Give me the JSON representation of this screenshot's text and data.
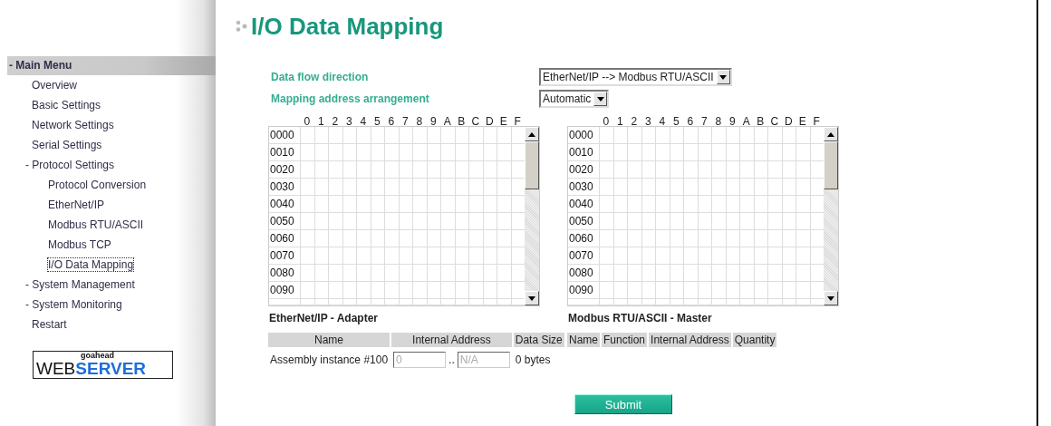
{
  "sidebar": {
    "header": "- Main Menu",
    "items": [
      {
        "label": "Overview",
        "kind": "page",
        "selected": false
      },
      {
        "label": "Basic Settings",
        "kind": "page",
        "selected": false
      },
      {
        "label": "Network Settings",
        "kind": "page",
        "selected": false
      },
      {
        "label": "Serial Settings",
        "kind": "page",
        "selected": false
      },
      {
        "label": "- Protocol Settings",
        "kind": "folder",
        "selected": false,
        "children": [
          {
            "label": "Protocol Conversion",
            "kind": "page",
            "selected": false
          },
          {
            "label": "EtherNet/IP",
            "kind": "page",
            "selected": false
          },
          {
            "label": "Modbus RTU/ASCII",
            "kind": "page",
            "selected": false
          },
          {
            "label": "Modbus TCP",
            "kind": "page",
            "selected": false
          },
          {
            "label": "I/O Data Mapping",
            "kind": "page",
            "selected": true
          }
        ]
      },
      {
        "label": "- System Management",
        "kind": "folder",
        "selected": false
      },
      {
        "label": "- System Monitoring",
        "kind": "folder",
        "selected": false
      },
      {
        "label": "Restart",
        "kind": "page",
        "selected": false
      }
    ],
    "logo": {
      "small": "goahead",
      "left": "WEB",
      "right": "SERVER"
    }
  },
  "title": "I/O Data Mapping",
  "settings": [
    {
      "label": "Data flow direction",
      "value": "EtherNet/IP --> Modbus RTU/ASCII"
    },
    {
      "label": "Mapping address arrangement",
      "value": "Automatic"
    }
  ],
  "grids": [
    {
      "columns": [
        "0",
        "1",
        "2",
        "3",
        "4",
        "5",
        "6",
        "7",
        "8",
        "9",
        "A",
        "B",
        "C",
        "D",
        "E",
        "F"
      ],
      "rows": [
        "0000",
        "0010",
        "0020",
        "0030",
        "0040",
        "0050",
        "0060",
        "0070",
        "0080",
        "0090"
      ]
    },
    {
      "columns": [
        "0",
        "1",
        "2",
        "3",
        "4",
        "5",
        "6",
        "7",
        "8",
        "9",
        "A",
        "B",
        "C",
        "D",
        "E",
        "F"
      ],
      "rows": [
        "0000",
        "0010",
        "0020",
        "0030",
        "0040",
        "0050",
        "0060",
        "0070",
        "0080",
        "0090"
      ]
    }
  ],
  "tables": [
    {
      "title": "EtherNet/IP - Adapter",
      "columns": [
        "Name",
        "Internal Address",
        "Data Size"
      ],
      "rows": [
        {
          "name": "Assembly instance #100",
          "start": "0",
          "separator": "..",
          "end": "N/A",
          "disabled": true,
          "size": "0 bytes"
        }
      ]
    },
    {
      "title": "Modbus RTU/ASCII - Master",
      "columns": [
        "Name",
        "Function",
        "Internal Address",
        "Quantity"
      ]
    }
  ],
  "submit": "Submit"
}
